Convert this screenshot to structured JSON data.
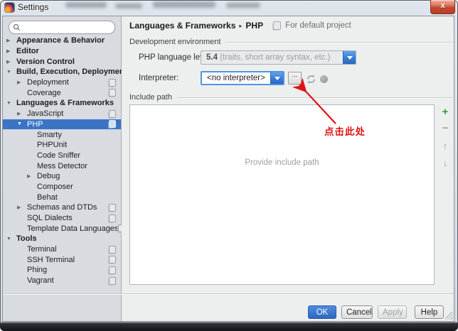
{
  "window": {
    "title": "Settings",
    "close_glyph": "x"
  },
  "sidebar": {
    "search_placeholder": "",
    "tree": [
      {
        "label": "Appearance & Behavior",
        "level": 0,
        "arrow": "right",
        "bold": true,
        "selected": false,
        "icon": false
      },
      {
        "label": "Editor",
        "level": 0,
        "arrow": "right",
        "bold": true,
        "selected": false,
        "icon": false
      },
      {
        "label": "Version Control",
        "level": 0,
        "arrow": "right",
        "bold": true,
        "selected": false,
        "icon": false
      },
      {
        "label": "Build, Execution, Deployment",
        "level": 0,
        "arrow": "down",
        "bold": true,
        "selected": false,
        "icon": false
      },
      {
        "label": "Deployment",
        "level": 1,
        "arrow": "right",
        "bold": false,
        "selected": false,
        "icon": true
      },
      {
        "label": "Coverage",
        "level": 1,
        "arrow": "none",
        "bold": false,
        "selected": false,
        "icon": true
      },
      {
        "label": "Languages & Frameworks",
        "level": 0,
        "arrow": "down",
        "bold": true,
        "selected": false,
        "icon": false
      },
      {
        "label": "JavaScript",
        "level": 1,
        "arrow": "right",
        "bold": false,
        "selected": false,
        "icon": true
      },
      {
        "label": "PHP",
        "level": 1,
        "arrow": "down",
        "bold": false,
        "selected": true,
        "icon": true
      },
      {
        "label": "Smarty",
        "level": 2,
        "arrow": "none",
        "bold": false,
        "selected": false,
        "icon": false
      },
      {
        "label": "PHPUnit",
        "level": 2,
        "arrow": "none",
        "bold": false,
        "selected": false,
        "icon": false
      },
      {
        "label": "Code Sniffer",
        "level": 2,
        "arrow": "none",
        "bold": false,
        "selected": false,
        "icon": false
      },
      {
        "label": "Mess Detector",
        "level": 2,
        "arrow": "none",
        "bold": false,
        "selected": false,
        "icon": false
      },
      {
        "label": "Debug",
        "level": 2,
        "arrow": "right",
        "bold": false,
        "selected": false,
        "icon": false
      },
      {
        "label": "Composer",
        "level": 2,
        "arrow": "none",
        "bold": false,
        "selected": false,
        "icon": false
      },
      {
        "label": "Behat",
        "level": 2,
        "arrow": "none",
        "bold": false,
        "selected": false,
        "icon": false
      },
      {
        "label": "Schemas and DTDs",
        "level": 1,
        "arrow": "right",
        "bold": false,
        "selected": false,
        "icon": true
      },
      {
        "label": "SQL Dialects",
        "level": 1,
        "arrow": "none",
        "bold": false,
        "selected": false,
        "icon": true
      },
      {
        "label": "Template Data Languages",
        "level": 1,
        "arrow": "none",
        "bold": false,
        "selected": false,
        "icon": true
      },
      {
        "label": "Tools",
        "level": 0,
        "arrow": "down",
        "bold": true,
        "selected": false,
        "icon": false
      },
      {
        "label": "Terminal",
        "level": 1,
        "arrow": "none",
        "bold": false,
        "selected": false,
        "icon": true
      },
      {
        "label": "SSH Terminal",
        "level": 1,
        "arrow": "none",
        "bold": false,
        "selected": false,
        "icon": true
      },
      {
        "label": "Phing",
        "level": 1,
        "arrow": "none",
        "bold": false,
        "selected": false,
        "icon": true
      },
      {
        "label": "Vagrant",
        "level": 1,
        "arrow": "none",
        "bold": false,
        "selected": false,
        "icon": true
      }
    ]
  },
  "breadcrumb": {
    "section": "Languages & Frameworks",
    "separator": "▸",
    "page": "PHP",
    "scope": "For default project"
  },
  "main": {
    "dev_env_label": "Development environment",
    "php_level_label": "PHP language level:",
    "php_level_value": "5.4",
    "php_level_note": " (traits, short array syntax, etc.)",
    "interpreter_label": "Interpreter:",
    "interpreter_value": "<no interpreter>",
    "browse_label": "...",
    "include_path_label": "Include path",
    "include_empty_text": "Provide include path",
    "include_toolbar": {
      "add": "+",
      "remove": "−",
      "move_up": "↑",
      "move_down": "↓"
    }
  },
  "annotation": {
    "text": "点击此处"
  },
  "footer": {
    "ok": "OK",
    "cancel": "Cancel",
    "apply": "Apply",
    "help": "Help"
  },
  "colors": {
    "selection_blue": "#3b74c4",
    "ok_blue": "#3a79d0",
    "focus_border_blue": "#4f94e3",
    "annotation_red": "#e01313",
    "add_green": "#2da12d",
    "sidebar_bg": "#d8dbe0",
    "panel_bg": "#edefef"
  }
}
